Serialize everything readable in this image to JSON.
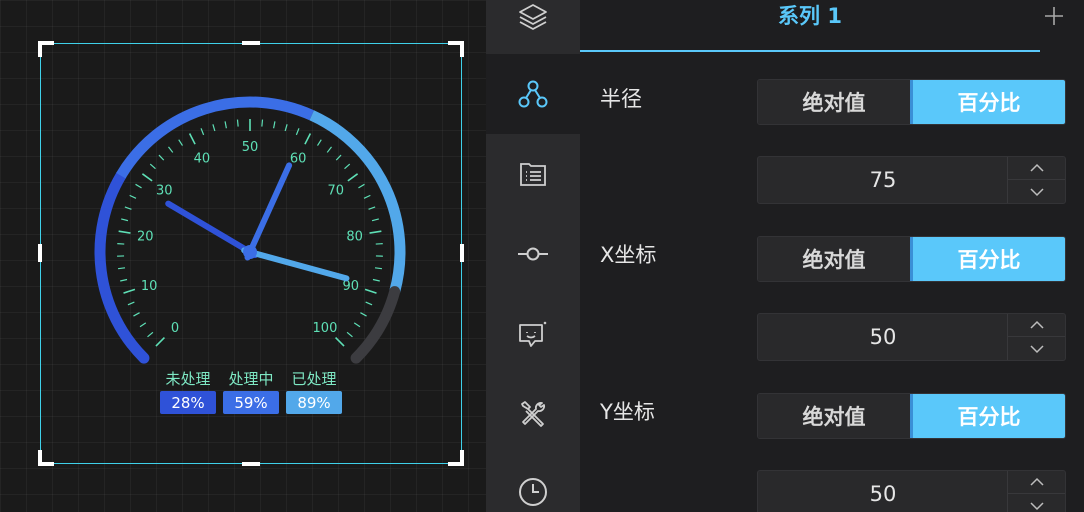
{
  "gauge": {
    "ticks": [
      "0",
      "10",
      "20",
      "30",
      "40",
      "50",
      "60",
      "70",
      "80",
      "90",
      "100"
    ],
    "pointers": [
      {
        "name": "未处理",
        "value": 28,
        "label": "28%",
        "color": "#2f52d8"
      },
      {
        "name": "处理中",
        "value": 59,
        "label": "59%",
        "color": "#3b6ee6"
      },
      {
        "name": "已处理",
        "value": 89,
        "label": "89%",
        "color": "#52a8ea"
      }
    ],
    "tick_color": "#5ee0b6",
    "track_color": "#3c3c40"
  },
  "rail": {
    "items": [
      {
        "icon": "layers-icon",
        "active": false
      },
      {
        "icon": "nodes-icon",
        "active": true
      },
      {
        "icon": "list-icon",
        "active": false
      },
      {
        "icon": "axis-point-icon",
        "active": false
      },
      {
        "icon": "tooltip-face-icon",
        "active": false
      },
      {
        "icon": "tools-icon",
        "active": false
      },
      {
        "icon": "clock-icon",
        "active": false
      }
    ]
  },
  "panel": {
    "series_tab": "系列 1",
    "add_label": "+",
    "radius": {
      "label": "半径",
      "abs": "绝对值",
      "pct": "百分比",
      "selected": "pct",
      "value": "75"
    },
    "x": {
      "label": "X坐标",
      "abs": "绝对值",
      "pct": "百分比",
      "selected": "pct",
      "value": "50"
    },
    "y": {
      "label": "Y坐标",
      "abs": "绝对值",
      "pct": "百分比",
      "selected": "pct",
      "value": "50"
    }
  },
  "colors": {
    "accent": "#5ac8fa",
    "selection": "#3fd1ea"
  }
}
